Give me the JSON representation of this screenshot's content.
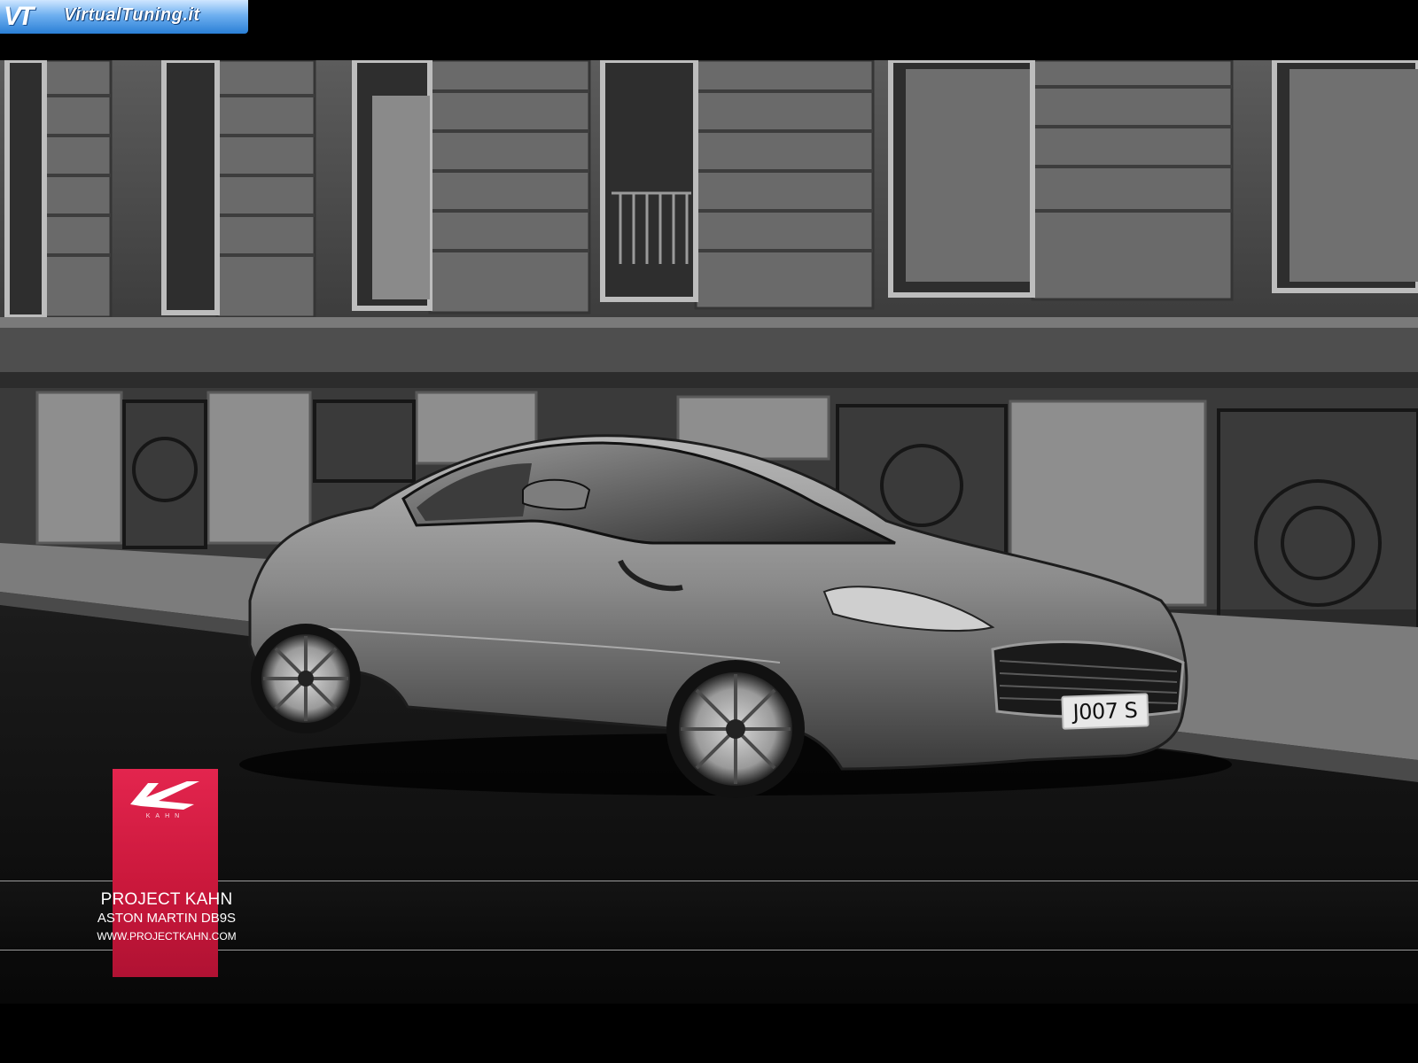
{
  "watermark": {
    "mark": "VT",
    "site": "VirtualTuning.it"
  },
  "photo": {
    "plate": "J007 S"
  },
  "badge": {
    "brand_word": "KAHN",
    "accent_color": "#d61d45"
  },
  "caption": {
    "title": "PROJECT KAHN",
    "model": "ASTON MARTIN DB9S",
    "url": "WWW.PROJECTKAHN.COM"
  }
}
